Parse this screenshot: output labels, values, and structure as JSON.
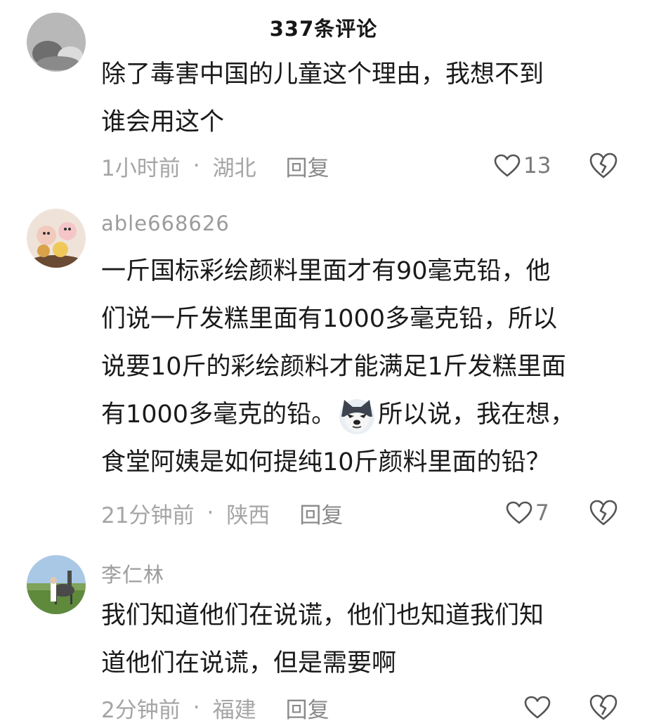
{
  "header": {
    "title": "337条评论"
  },
  "comments": [
    {
      "username": "",
      "lines": [
        "除了毒害中国的儿童这个理由，我想不到",
        "谁会用这个"
      ],
      "time": "1小时前",
      "location": "湖北",
      "reply_label": "回复",
      "likes": "13"
    },
    {
      "username": "able668626",
      "lines": [
        "一斤国标彩绘颜料里面才有90毫克铅，他",
        "们说一斤发糕里面有1000多毫克铅，所以",
        "说要10斤的彩绘颜料才能满足1斤发糕里面",
        "有1000多毫克的铅。",
        "食堂阿姨是如何提纯10斤颜料里面的铅？"
      ],
      "line4_after_emoji": "所以说，我在想，",
      "time": "21分钟前",
      "location": "陕西",
      "reply_label": "回复",
      "likes": "7"
    },
    {
      "username": "李仁林",
      "lines": [
        "我们知道他们在说谎，他们也知道我们知",
        "道他们在说谎，但是需要啊"
      ],
      "time": "2分钟前",
      "location": "福建",
      "reply_label": "回复",
      "likes": ""
    }
  ],
  "colors": {
    "text": "#1a1a1a",
    "meta": "#a5a5a5",
    "icon": "#555555"
  }
}
